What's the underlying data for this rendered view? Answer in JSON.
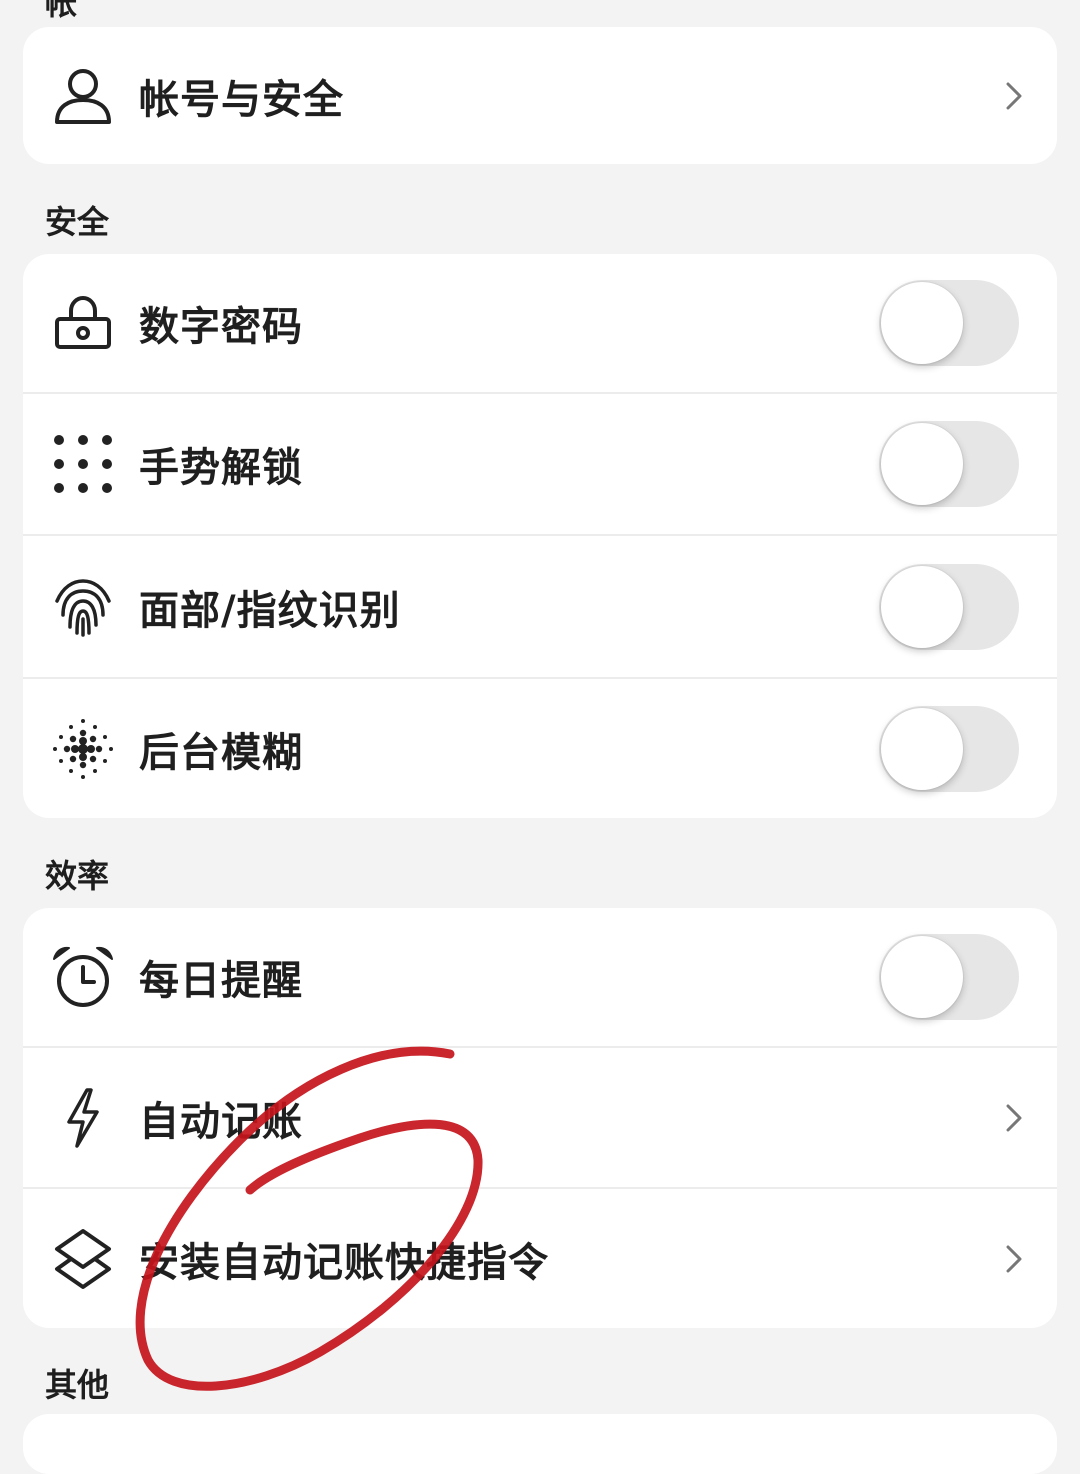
{
  "top_partial_header": "帐",
  "account_card": {
    "label": "帐号与安全",
    "icon": "user-icon"
  },
  "security_section": {
    "title": "安全",
    "items": [
      {
        "label": "数字密码",
        "icon": "lock-icon",
        "toggle_on": false
      },
      {
        "label": "手势解锁",
        "icon": "dots-grid-icon",
        "toggle_on": false
      },
      {
        "label": "面部/指纹识别",
        "icon": "fingerprint-icon",
        "toggle_on": false
      },
      {
        "label": "后台模糊",
        "icon": "blur-dots-icon",
        "toggle_on": false
      }
    ]
  },
  "efficiency_section": {
    "title": "效率",
    "items": [
      {
        "label": "每日提醒",
        "icon": "alarm-clock-icon",
        "toggle_on": false
      },
      {
        "label": "自动记账",
        "icon": "lightning-icon"
      },
      {
        "label": "安装自动记账快捷指令",
        "icon": "shortcuts-icon"
      }
    ]
  },
  "other_section": {
    "title": "其他"
  },
  "colors": {
    "background": "#f3f3f3",
    "card": "#ffffff",
    "toggle_off_track": "#e6e6e6",
    "annotation_red": "#c4141b"
  }
}
